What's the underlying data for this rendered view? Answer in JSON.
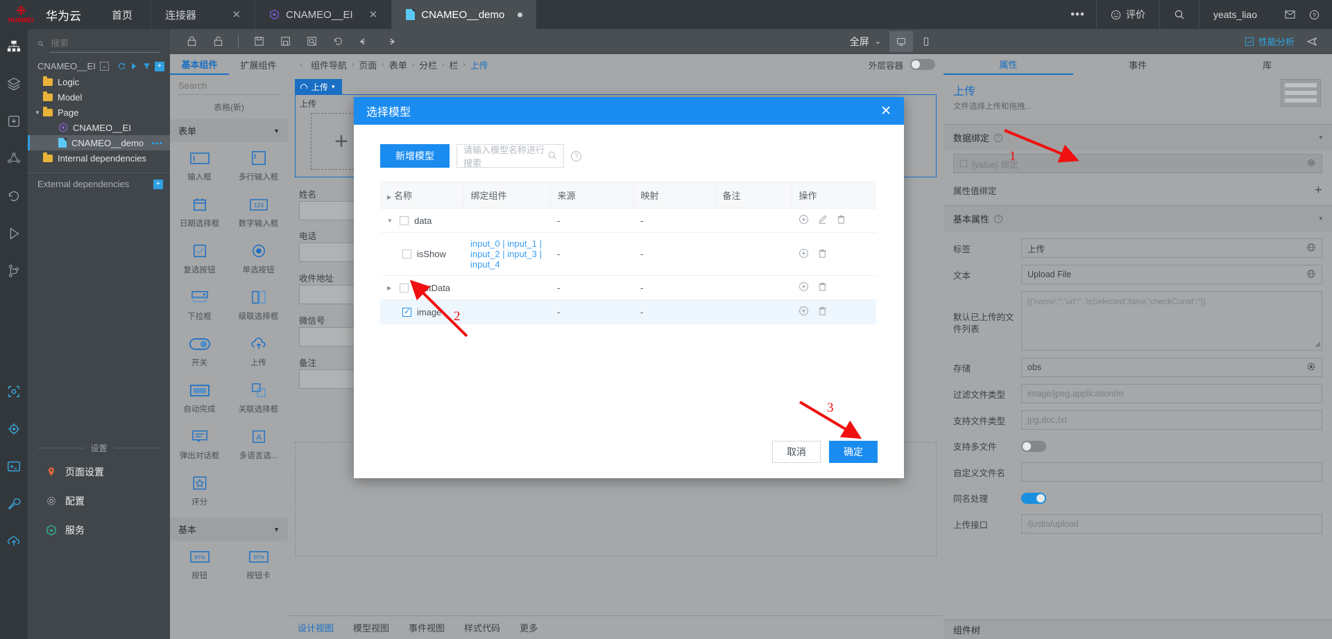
{
  "topbar": {
    "brand": "华为云",
    "brand_sub": "HUAWEI",
    "home": "首页",
    "tabs": [
      {
        "label": "连接器",
        "close": "✕",
        "icon": "none",
        "active": false
      },
      {
        "label": "CNAMEO__EI",
        "close": "✕",
        "icon": "hexagon-icon",
        "active": false
      },
      {
        "label": "CNAMEO__demo",
        "close": "",
        "icon": "file-icon",
        "active": true,
        "modified": true
      }
    ],
    "more": "•••",
    "rate": "评价",
    "search_icon": "search-icon",
    "user": "yeats_liao",
    "mail_icon": "mail-icon",
    "help_icon": "help-icon"
  },
  "toolbar": {
    "icons": [
      "lock-closed-icon",
      "lock-open-icon",
      "divider",
      "save-icon",
      "save-as-icon",
      "preview-icon",
      "history-icon",
      "undo-icon",
      "redo-icon"
    ],
    "fullscreen": "全屏",
    "chevron": "⌄",
    "desktop_icon": "desktop-icon",
    "mobile_icon": "mobile-icon",
    "performance": "性能分析",
    "send_icon": "send-icon"
  },
  "rail": {
    "items": [
      "sitemap-icon",
      "layers-icon",
      "package-icon",
      "api-icon",
      "history-icon",
      "run-icon",
      "branch-icon",
      "preview-eye-icon",
      "target-icon",
      "terminal-icon",
      "wrench-icon",
      "deploy-icon"
    ]
  },
  "tree": {
    "search_placeholder": "搜索",
    "search_value": "",
    "project": "CNAMEO__EI",
    "nodes": [
      {
        "label": "Logic",
        "level": 1,
        "type": "folder",
        "expanded": false
      },
      {
        "label": "Model",
        "level": 1,
        "type": "folder",
        "expanded": false
      },
      {
        "label": "Page",
        "level": 1,
        "type": "folder",
        "expanded": true
      },
      {
        "label": "CNAMEO__EI",
        "level": 2,
        "type": "hexagon",
        "expanded": false
      },
      {
        "label": "CNAMEO__demo",
        "level": 2,
        "type": "page",
        "selected": true,
        "menu": "•••"
      },
      {
        "label": "Internal dependencies",
        "level": 1,
        "type": "folder",
        "expanded": false
      }
    ],
    "external_dependencies": "External dependencies",
    "settings_divider": "设置",
    "settings_items": [
      {
        "label": "页面设置",
        "icon": "pin-icon",
        "color": "#e8693d"
      },
      {
        "label": "配置",
        "icon": "gear-icon",
        "color": "#9aa1a8"
      },
      {
        "label": "服务",
        "icon": "service-icon",
        "color": "#2fc49b"
      }
    ]
  },
  "palette": {
    "tabs": [
      {
        "label": "基本组件",
        "active": true
      },
      {
        "label": "扩展组件",
        "active": false
      }
    ],
    "search_placeholder": "Search",
    "group_header": "表格(新)",
    "group_form": "表单",
    "items": [
      {
        "label": "输入框",
        "icon": "input-icon"
      },
      {
        "label": "多行输入框",
        "icon": "textarea-icon"
      },
      {
        "label": "日期选择框",
        "icon": "calendar-icon"
      },
      {
        "label": "数字输入框",
        "icon": "number-icon"
      },
      {
        "label": "复选按钮",
        "icon": "checkbox-icon"
      },
      {
        "label": "单选按钮",
        "icon": "radio-icon"
      },
      {
        "label": "下拉框",
        "icon": "select-icon"
      },
      {
        "label": "级联选择框",
        "icon": "cascader-icon"
      },
      {
        "label": "开关",
        "icon": "switch-icon"
      },
      {
        "label": "上传",
        "icon": "upload-icon"
      },
      {
        "label": "自动完成",
        "icon": "autocomplete-icon"
      },
      {
        "label": "关联选择框",
        "icon": "relation-icon"
      },
      {
        "label": "弹出对话框",
        "icon": "dialog-icon"
      },
      {
        "label": "多语言选...",
        "icon": "i18n-icon"
      },
      {
        "label": "评分",
        "icon": "star-icon"
      }
    ],
    "group_basic": "基本",
    "basic_items": [
      {
        "label": "按钮",
        "icon": "button-icon",
        "glyph": "BTN"
      },
      {
        "label": "按钮卡",
        "icon": "button-card-icon",
        "glyph": "BTN"
      }
    ]
  },
  "canvas": {
    "breadcrumb": [
      "组件导航",
      "页面",
      "表单",
      "分栏",
      "栏",
      "上传"
    ],
    "breadcrumb_active": "上传",
    "outer_container_label": "外层容器",
    "outer_container_on": false,
    "component_tag": "上传",
    "component_tag_caret": "▾",
    "upload_label": "上传",
    "plus": "+",
    "form_fields": [
      {
        "label": "姓名"
      },
      {
        "label": "电话"
      },
      {
        "label": "收件地址"
      },
      {
        "label": "微信号"
      },
      {
        "label": "备注"
      }
    ],
    "view_tabs": [
      {
        "label": "设计视图",
        "active": true
      },
      {
        "label": "模型视图",
        "active": false
      },
      {
        "label": "事件视图",
        "active": false
      },
      {
        "label": "样式代码",
        "active": false
      },
      {
        "label": "更多",
        "active": false
      }
    ]
  },
  "modal": {
    "title": "选择模型",
    "close": "✕",
    "new_model_button": "新增模型",
    "search_placeholder": "请输入模型名称进行搜索",
    "help_icon": "help-icon",
    "columns": [
      "名称",
      "绑定组件",
      "来源",
      "映射",
      "备注",
      "操作"
    ],
    "rows": [
      {
        "name": "data",
        "indent": 0,
        "caret": "▾",
        "checked": false,
        "bound": "",
        "source": "-",
        "mapping": "-",
        "remark": "",
        "ops": [
          "add-icon",
          "edit-icon",
          "delete-icon"
        ]
      },
      {
        "name": "isShow",
        "indent": 1,
        "caret": "",
        "checked": false,
        "bound": "input_0 | input_1 | input_2 | input_3 | input_4",
        "source": "-",
        "mapping": "-",
        "remark": "",
        "ops": [
          "add-icon",
          "delete-icon"
        ]
      },
      {
        "name": "postData",
        "indent": 0,
        "caret": "▸",
        "checked": false,
        "bound": "",
        "source": "-",
        "mapping": "-",
        "remark": "",
        "ops": [
          "add-icon",
          "delete-icon"
        ]
      },
      {
        "name": "image",
        "indent": 1,
        "caret": "",
        "checked": true,
        "selected": true,
        "bound": "",
        "source": "-",
        "mapping": "-",
        "remark": "",
        "ops": [
          "add-icon",
          "delete-icon"
        ]
      }
    ],
    "cancel": "取消",
    "confirm": "确定"
  },
  "props": {
    "tabs": [
      {
        "label": "属性",
        "active": true
      },
      {
        "label": "事件",
        "active": false
      },
      {
        "label": "库",
        "active": false
      }
    ],
    "title": "上传",
    "subtitle": "文件选择上传和拖拽...",
    "sections": [
      {
        "label": "数据绑定",
        "help": true,
        "chevron": "▾"
      },
      {
        "label": "基本属性",
        "help": true,
        "chevron": "▾"
      }
    ],
    "binding_value": "{value} 绑定",
    "binding_icon": "gear-icon",
    "attr_value_binding": "属性值绑定",
    "attr_add": "+",
    "fields": [
      {
        "label": "标签",
        "value": "上传",
        "placeholder": "",
        "icon": "globe-icon",
        "type": "text"
      },
      {
        "label": "文本",
        "value": "Upload File",
        "placeholder": "",
        "icon": "globe-icon",
        "type": "text"
      },
      {
        "label": "默认已上传的文件列表",
        "value": "",
        "placeholder": "[{'name':'','url':'','isSelected':false,'checkConst':''}]",
        "icon": "",
        "type": "textarea"
      },
      {
        "label": "存储",
        "value": "obs",
        "placeholder": "",
        "icon": "gear-icon",
        "type": "text"
      },
      {
        "label": "过滤文件类型",
        "value": "",
        "placeholder": "image/jpeg,application/m",
        "icon": "",
        "type": "text"
      },
      {
        "label": "支持文件类型",
        "value": "",
        "placeholder": "jpg,doc,txt",
        "icon": "",
        "type": "text"
      },
      {
        "label": "支持多文件",
        "value": "off",
        "placeholder": "",
        "icon": "",
        "type": "toggle"
      },
      {
        "label": "自定义文件名",
        "value": "",
        "placeholder": "",
        "icon": "",
        "type": "text"
      },
      {
        "label": "同名处理",
        "value": "on",
        "placeholder": "",
        "icon": "",
        "type": "toggle"
      },
      {
        "label": "上传接口",
        "value": "",
        "placeholder": "/justio/upload",
        "icon": "",
        "type": "text"
      }
    ],
    "component_tree": "组件树"
  },
  "annotations": [
    {
      "number": "1"
    },
    {
      "number": "2"
    },
    {
      "number": "3"
    }
  ]
}
